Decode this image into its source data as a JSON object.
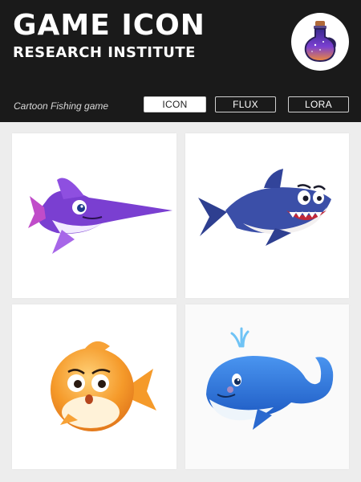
{
  "header": {
    "title": "GAME ICON",
    "subtitle": "RESEARCH INSTITUTE",
    "logo_icon": "potion-bottle-icon"
  },
  "toolbar": {
    "caption": "Cartoon Fishing game",
    "tabs": [
      {
        "label": "ICON",
        "active": true
      },
      {
        "label": "FLUX",
        "active": false
      },
      {
        "label": "LORA",
        "active": false
      }
    ]
  },
  "gallery": {
    "items": [
      {
        "icon": "swordfish-icon"
      },
      {
        "icon": "shark-icon"
      },
      {
        "icon": "pufferfish-icon"
      },
      {
        "icon": "whale-icon"
      }
    ]
  },
  "colors": {
    "header_bg": "#1a1a1a",
    "page_bg": "#ededed",
    "swordfish": "#7a3fd1",
    "shark": "#3b4fa8",
    "pufferfish": "#f59a2a",
    "whale": "#2f73d8"
  }
}
